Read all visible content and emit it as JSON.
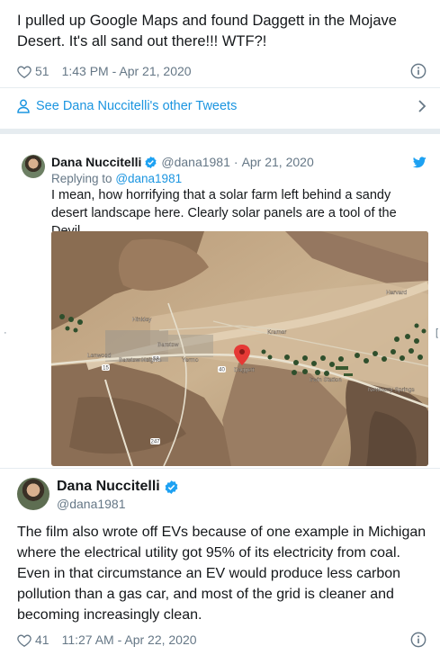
{
  "top_tweet": {
    "text": "I pulled up Google Maps and found Daggett in the Mojave Desert. It's all sand out there!!! WTF?!",
    "likes": "51",
    "time": "1:43 PM - Apr 21, 2020"
  },
  "see_others": {
    "label": "See Dana Nuccitelli's other Tweets"
  },
  "quoted_tweet": {
    "author_name": "Dana Nuccitelli",
    "handle": "@dana1981",
    "separator": "·",
    "date": "Apr 21, 2020",
    "replying_prefix": "Replying to",
    "replying_handle": "@dana1981",
    "text": "I mean, how horrifying that a solar farm left behind a sandy desert landscape here. Clearly solar panels are a tool of the Devil.",
    "map_labels": {
      "hinkley": "Hinkley",
      "lenwood": "Lenwood",
      "barstow": "Barstow",
      "barstow_heights": "Barstow Heights",
      "yermo": "Yermo",
      "daggett": "Daggett",
      "harvard": "Harvard",
      "newberry_springs": "Newberry Springs",
      "irwin_station": "Irwin Station",
      "kramer": "Kramer",
      "route_15": "15",
      "route_40": "40",
      "route_58": "58",
      "route_247": "247"
    }
  },
  "main_tweet": {
    "author_name": "Dana Nuccitelli",
    "handle": "@dana1981",
    "text": "The film also wrote off EVs because of one example in Michigan where the electrical utility got 95% of its electricity from coal. Even in that circumstance an EV would produce less carbon pollution than a gas car, and most of the grid is cleaner and becoming increasingly clean.",
    "likes": "41",
    "time": "11:27 AM - Apr 22, 2020"
  },
  "colors": {
    "link_blue": "#1b95e0",
    "like_gray": "#657786",
    "verified_blue": "#1da1f2",
    "divider": "#e6ecf0",
    "map_pin": "#e53935"
  },
  "icons": {
    "like": "heart-outline-icon",
    "info": "info-circle-icon",
    "person": "person-outline-icon",
    "chevron": "chevron-right-icon",
    "verified": "verified-badge-icon",
    "bird": "twitter-bird-icon",
    "map_pin": "map-pin-icon"
  }
}
